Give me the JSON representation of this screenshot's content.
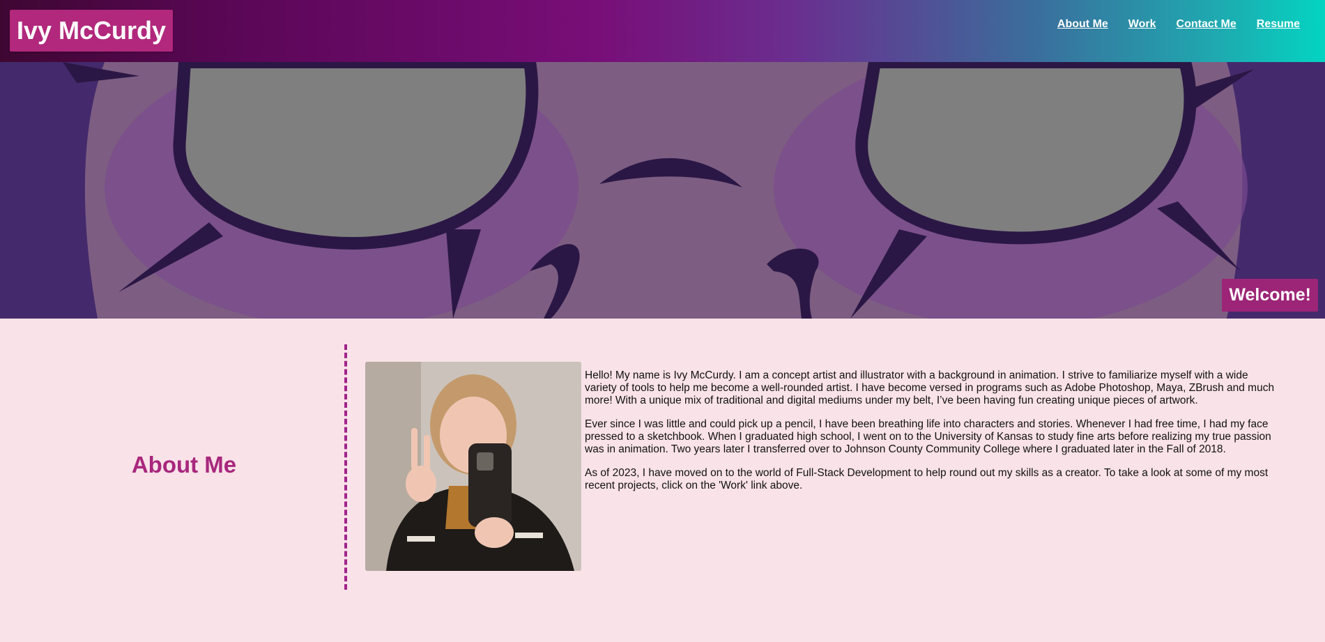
{
  "header": {
    "logo": "Ivy McCurdy",
    "nav": [
      {
        "label": "About Me"
      },
      {
        "label": "Work"
      },
      {
        "label": "Contact Me"
      },
      {
        "label": "Resume"
      }
    ]
  },
  "hero": {
    "welcome": "Welcome!"
  },
  "about": {
    "title": "About Me",
    "paragraphs": [
      "Hello! My name is Ivy McCurdy. I am a concept artist and illustrator with a background in animation. I strive to familiarize myself with a wide variety of tools to help me become a well-rounded artist. I have become versed in programs such as Adobe Photoshop, Maya, ZBrush and much more! With a unique mix of traditional and digital mediums under my belt, I’ve been having fun creating unique pieces of artwork.",
      "Ever since I was little and could pick up a pencil, I have been breathing life into characters and stories. Whenever I had free time, I had my face pressed to a sketchbook. When I graduated high school, I went on to the University of Kansas to study fine arts before realizing my true passion was in animation. Two years later I transferred over to Johnson County Community College where I graduated later in the Fall of 2018.",
      "As of 2023, I have moved on to the world of Full-Stack Development to help round out my skills as a creator. To take a look at some of my most recent projects, click on the 'Work' link above."
    ]
  },
  "colors": {
    "accent": "#a8277d",
    "background": "#f9e2e8"
  }
}
